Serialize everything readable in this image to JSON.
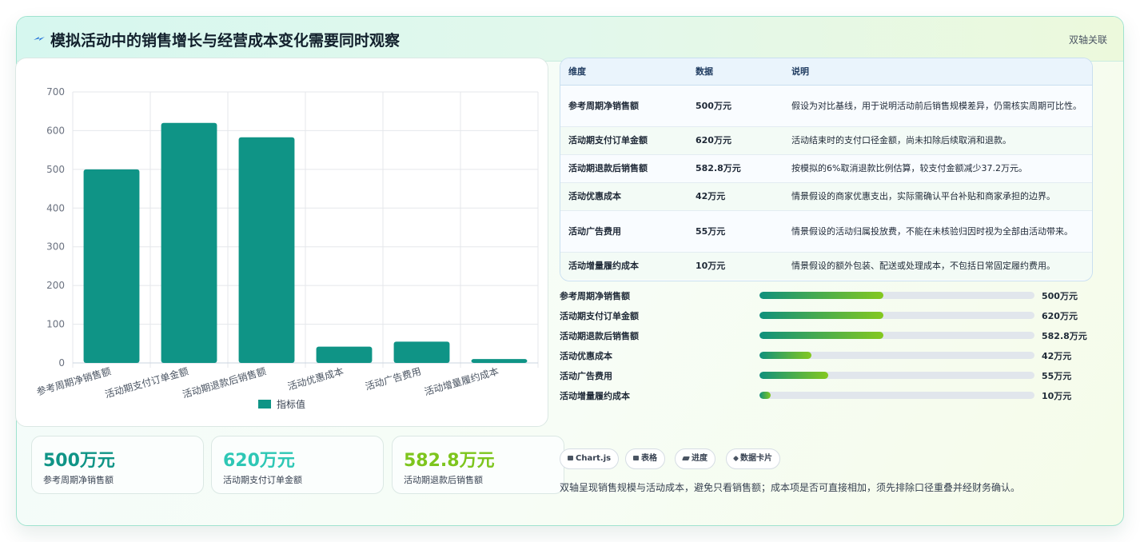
{
  "header": {
    "title": "模拟活动中的销售增长与经营成本变化需要同时观察",
    "tag": "双轴关联",
    "accent": "#0f9486"
  },
  "chart_data": {
    "type": "bar",
    "categories": [
      "参考周期净销售额",
      "活动期支付订单金额",
      "活动期退款后销售额",
      "活动优惠成本",
      "活动广告费用",
      "活动增量履约成本"
    ],
    "series": [
      {
        "name": "指标值",
        "values": [
          500,
          620,
          582.8,
          42,
          55,
          10
        ],
        "color": "#0f9486"
      }
    ],
    "yticks": [
      "0",
      "100",
      "200",
      "300",
      "400",
      "500",
      "600",
      "700"
    ],
    "ylim": [
      0,
      700
    ],
    "grid": true,
    "legend": "bottom"
  },
  "kpis": [
    {
      "value": "500万元",
      "label": "参考周期净销售额",
      "color": "#0f9486"
    },
    {
      "value": "620万元",
      "label": "活动期支付订单金额",
      "color": "#2ec7b5"
    },
    {
      "value": "582.8万元",
      "label": "活动期退款后销售额",
      "color": "#7dc51d"
    }
  ],
  "table": {
    "headers": [
      "维度",
      "数据",
      "说明"
    ],
    "rows": [
      {
        "dim": "参考周期净销售额",
        "val": "500万元",
        "desc": "假设为对比基线，用于说明活动前后销售规模差异，仍需核实周期可比性。"
      },
      {
        "dim": "活动期支付订单金额",
        "val": "620万元",
        "desc": "活动结束时的支付口径金额，尚未扣除后续取消和退款。"
      },
      {
        "dim": "活动期退款后销售额",
        "val": "582.8万元",
        "desc": "按模拟的6%取消退款比例估算，较支付金额减少37.2万元。"
      },
      {
        "dim": "活动优惠成本",
        "val": "42万元",
        "desc": "情景假设的商家优惠支出，实际需确认平台补贴和商家承担的边界。"
      },
      {
        "dim": "活动广告费用",
        "val": "55万元",
        "desc": "情景假设的活动归属投放费，不能在未核验归因时视为全部由活动带来。"
      },
      {
        "dim": "活动增量履约成本",
        "val": "10万元",
        "desc": "情景假设的额外包装、配送或处理成本，不包括日常固定履约费用。"
      }
    ]
  },
  "progress": [
    {
      "label": "参考周期净销售额",
      "value": "500万元",
      "fraction": 0.45
    },
    {
      "label": "活动期支付订单金额",
      "value": "620万元",
      "fraction": 0.45
    },
    {
      "label": "活动期退款后销售额",
      "value": "582.8万元",
      "fraction": 0.45
    },
    {
      "label": "活动优惠成本",
      "value": "42万元",
      "fraction": 0.19
    },
    {
      "label": "活动广告费用",
      "value": "55万元",
      "fraction": 0.25
    },
    {
      "label": "活动增量履约成本",
      "value": "10万元",
      "fraction": 0.04
    }
  ],
  "chips": [
    {
      "label": "Chart.js",
      "icon": "chart-icon"
    },
    {
      "label": "表格",
      "icon": "table-icon"
    },
    {
      "label": "进度",
      "icon": "progress-icon"
    },
    {
      "label": "数据卡片",
      "icon": "sparkle-icon"
    }
  ],
  "note": "双轴呈现销售规模与活动成本，避免只看销售额；成本项是否可直接相加，须先排除口径重叠并经财务确认。"
}
